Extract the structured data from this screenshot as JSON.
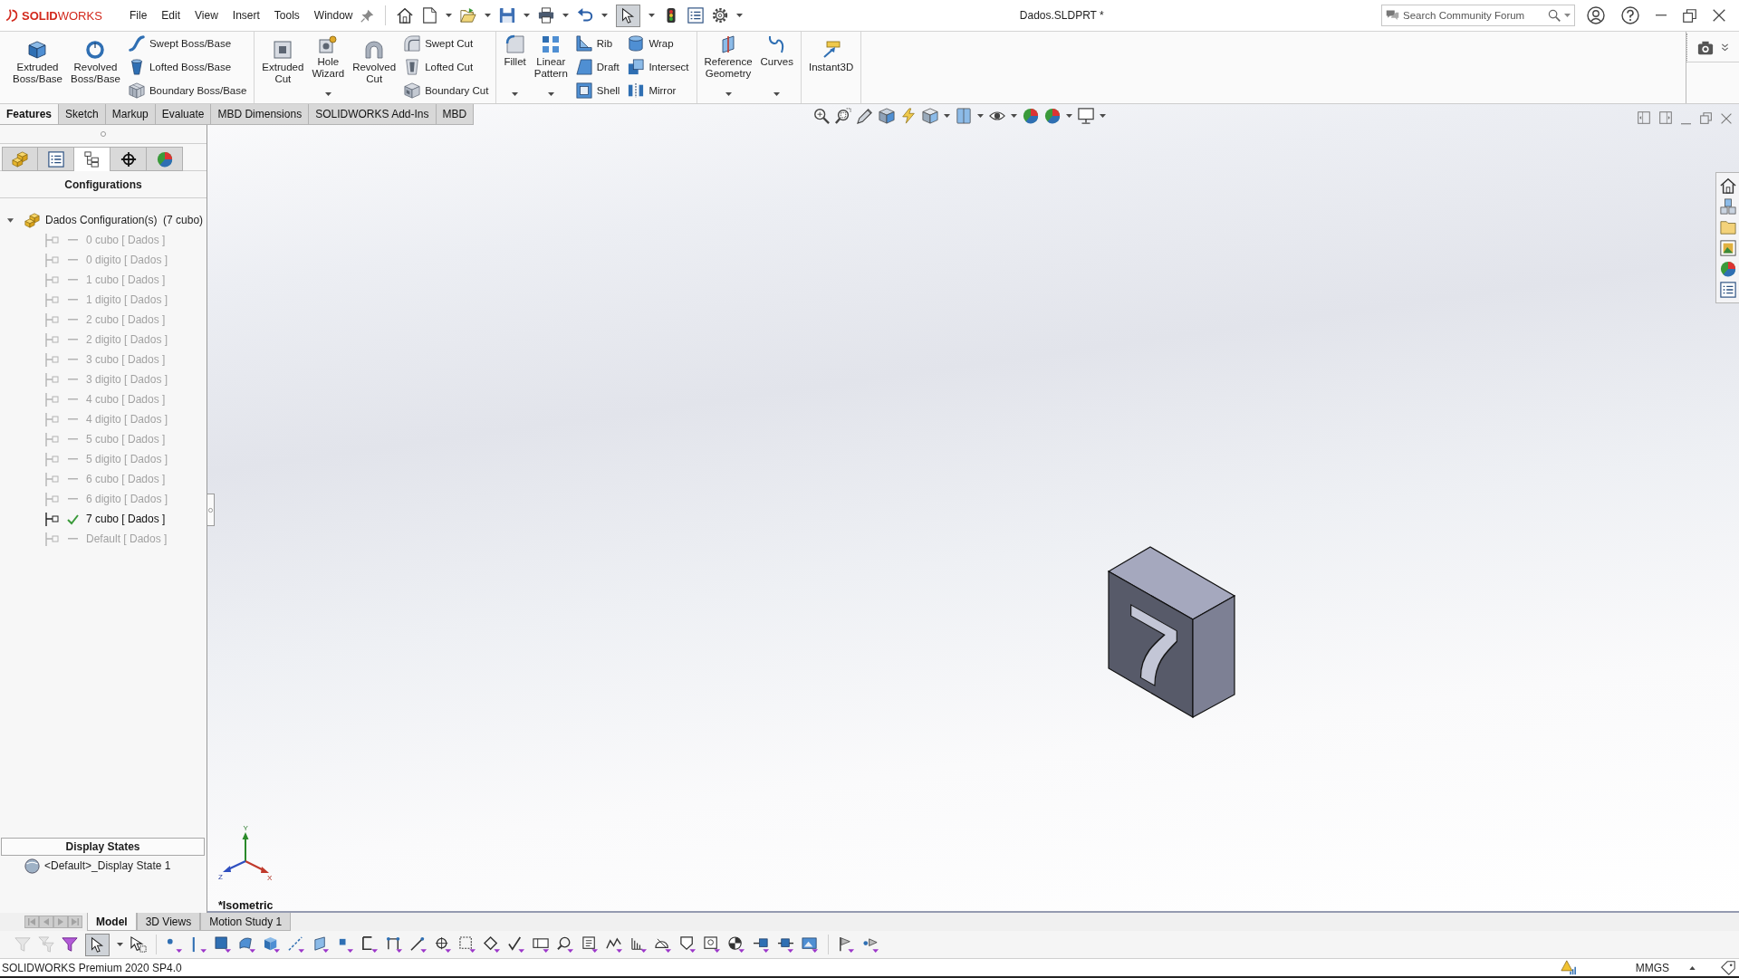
{
  "window": {
    "title": "Dados.SLDPRT *"
  },
  "logo": {
    "text": "**SOLID**WORKS"
  },
  "menu": [
    "File",
    "Edit",
    "View",
    "Insert",
    "Tools",
    "Window"
  ],
  "search": {
    "placeholder": "Search Community Forum"
  },
  "ribbon": [
    {
      "items": [
        {
          "kind": "large",
          "label": "Extruded Boss/Base",
          "dropdown": false
        },
        {
          "kind": "large",
          "label": "Revolved Boss/Base",
          "dropdown": false
        },
        {
          "kind": "stack",
          "items": [
            "Swept Boss/Base",
            "Lofted Boss/Base",
            "Boundary Boss/Base"
          ]
        }
      ]
    },
    {
      "items": [
        {
          "kind": "large",
          "label": "Extruded Cut",
          "dropdown": false
        },
        {
          "kind": "large",
          "label": "Hole Wizard",
          "dropdown": true
        },
        {
          "kind": "large",
          "label": "Revolved Cut",
          "dropdown": false
        },
        {
          "kind": "stack",
          "items": [
            "Swept Cut",
            "Lofted Cut",
            "Boundary Cut"
          ]
        }
      ]
    },
    {
      "items": [
        {
          "kind": "large",
          "label": "Fillet",
          "dropdown": true
        },
        {
          "kind": "large",
          "label": "Linear Pattern",
          "dropdown": true
        },
        {
          "kind": "stack",
          "items": [
            "Rib",
            "Draft",
            "Shell"
          ]
        },
        {
          "kind": "stack",
          "items": [
            "Wrap",
            "Intersect",
            "Mirror"
          ]
        }
      ]
    },
    {
      "items": [
        {
          "kind": "large",
          "label": "Reference Geometry",
          "dropdown": true
        },
        {
          "kind": "large",
          "label": "Curves",
          "dropdown": true
        }
      ]
    },
    {
      "items": [
        {
          "kind": "large",
          "label": "Instant3D",
          "dropdown": false
        }
      ]
    }
  ],
  "command_tabs": [
    {
      "label": "Features",
      "selected": true
    },
    {
      "label": "Sketch",
      "selected": false
    },
    {
      "label": "Markup",
      "selected": false
    },
    {
      "label": "Evaluate",
      "selected": false
    },
    {
      "label": "MBD Dimensions",
      "selected": false
    },
    {
      "label": "SOLIDWORKS Add-Ins",
      "selected": false
    },
    {
      "label": "MBD",
      "selected": false
    }
  ],
  "panel_tabs": [
    {
      "selected": false
    },
    {
      "selected": false
    },
    {
      "selected": true
    },
    {
      "selected": false
    },
    {
      "selected": false
    }
  ],
  "configurations": {
    "title": "Configurations",
    "root": {
      "label": "Dados Configuration(s)  (7 cubo)",
      "expanded": true,
      "children": [
        {
          "label": "0 cubo [ Dados ]",
          "active": false
        },
        {
          "label": "0 digito [ Dados ]",
          "active": false
        },
        {
          "label": "1 cubo [ Dados ]",
          "active": false
        },
        {
          "label": "1 digito [ Dados ]",
          "active": false
        },
        {
          "label": "2 cubo [ Dados ]",
          "active": false
        },
        {
          "label": "2 digito [ Dados ]",
          "active": false
        },
        {
          "label": "3 cubo [ Dados ]",
          "active": false
        },
        {
          "label": "3 digito [ Dados ]",
          "active": false
        },
        {
          "label": "4 cubo [ Dados ]",
          "active": false
        },
        {
          "label": "4 digito [ Dados ]",
          "active": false
        },
        {
          "label": "5 cubo [ Dados ]",
          "active": false
        },
        {
          "label": "5 digito [ Dados ]",
          "active": false
        },
        {
          "label": "6 cubo [ Dados ]",
          "active": false
        },
        {
          "label": "6 digito [ Dados ]",
          "active": false
        },
        {
          "label": "7 cubo [ Dados ]",
          "active": true
        },
        {
          "label": "Default [ Dados ]",
          "active": false
        }
      ]
    }
  },
  "display_states": {
    "title": "Display States",
    "items": [
      {
        "label": "<Default>_Display State 1"
      }
    ]
  },
  "viewport": {
    "view_name": "*Isometric",
    "triad": {
      "x": "X",
      "y": "Y",
      "z": "Z"
    },
    "model": {
      "digit": "7"
    }
  },
  "bottom_tabs": [
    {
      "label": "Model",
      "selected": true
    },
    {
      "label": "3D Views",
      "selected": false
    },
    {
      "label": "Motion Study 1",
      "selected": false
    }
  ],
  "status_bar": {
    "text": "SOLIDWORKS Premium 2020 SP4.0",
    "units": "MMGS"
  }
}
